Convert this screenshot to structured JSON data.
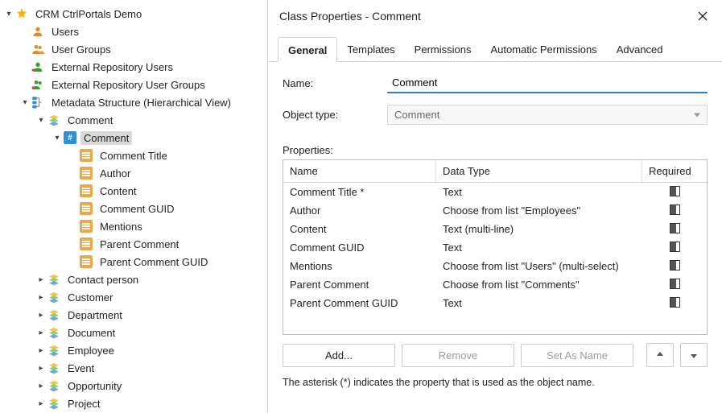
{
  "tree": {
    "root": "CRM CtrlPortals Demo",
    "users": "Users",
    "user_groups": "User Groups",
    "ext_users": "External Repository Users",
    "ext_groups": "External Repository User Groups",
    "meta": "Metadata Structure (Hierarchical View)",
    "comment_class": "Comment",
    "comment_sel": "Comment",
    "props": {
      "title": "Comment Title",
      "author": "Author",
      "content": "Content",
      "guid": "Comment GUID",
      "mentions": "Mentions",
      "parent": "Parent Comment",
      "parent_guid": "Parent Comment GUID"
    },
    "others": {
      "contact": "Contact person",
      "customer": "Customer",
      "department": "Department",
      "document": "Document",
      "employee": "Employee",
      "event": "Event",
      "opportunity": "Opportunity",
      "project": "Project"
    }
  },
  "dialog": {
    "title": "Class Properties - Comment",
    "tabs": {
      "general": "General",
      "templates": "Templates",
      "permissions": "Permissions",
      "auto_perm": "Automatic Permissions",
      "advanced": "Advanced"
    },
    "form": {
      "name_label": "Name:",
      "name_value": "Comment",
      "objtype_label": "Object type:",
      "objtype_value": "Comment",
      "props_label": "Properties:"
    },
    "cols": {
      "name": "Name",
      "type": "Data Type",
      "req": "Required"
    },
    "rows": [
      {
        "name": "Comment Title *",
        "type": "Text"
      },
      {
        "name": "Author",
        "type": "Choose from list \"Employees\""
      },
      {
        "name": "Content",
        "type": "Text (multi-line)"
      },
      {
        "name": "Comment GUID",
        "type": "Text"
      },
      {
        "name": "Mentions",
        "type": "Choose from list \"Users\" (multi-select)"
      },
      {
        "name": "Parent Comment",
        "type": "Choose from list \"Comments\""
      },
      {
        "name": "Parent Comment GUID",
        "type": "Text"
      }
    ],
    "buttons": {
      "add": "Add...",
      "remove": "Remove",
      "setname": "Set As Name"
    },
    "footnote": "The asterisk (*) indicates the property that is used as the object name."
  }
}
